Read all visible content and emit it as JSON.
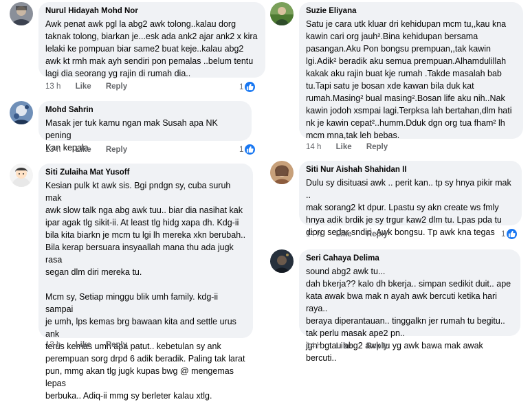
{
  "comments": [
    {
      "author": "Nurul Hidayah Mohd Nor",
      "text": "Awk penat awk pgl la abg2 awk tolong..kalau dorg\ntaknak tolong, biarkan je...esk ada ank2 ajar ank2 x kira\nlelaki ke pompuan biar same2 buat keje..kalau abg2\nawk kt rmh mak ayh sendiri pon pemalas ..belum tentu\nlagi dia seorang yg rajin di rumah dia..",
      "time": "13 h",
      "like": "Like",
      "reply": "Reply",
      "reaction_count": "1",
      "avatar_icon": "profile-photo-icon"
    },
    {
      "author": "Mohd Sahrin",
      "text": "Masak jer tuk kamu ngan mak Susah apa NK pening\nKan kepala",
      "time": "13 h",
      "like": "Like",
      "reply": "Reply",
      "reaction_count": "1",
      "avatar_icon": "profile-photo-icon"
    },
    {
      "author": "Siti Zulaiha Mat Yusoff",
      "text": "Kesian pulk kt awk sis. Bgi pndgn sy, cuba suruh mak\nawk slow talk nga abg awk tuu.. biar dia nasihat kak\nipar agak tlg sikit-ii. At least tlg hidg xapa dh. Kdg-ii\nbila kita biarkn je mcm tu lgi lh mereka xkn berubah..\nBila kerap bersuara insyaallah mana thu ada jugk rasa\nsegan dlm diri mereka tu.\n\nMcm sy, Setiap minggu blik umh family. kdg-ii sampai\nje umh, lps kemas brg bawaan kita and settle urus ank\nterus kemas umh apa patut.. kebetulan sy ank\nperempuan sorg drpd 6 adik beradik. Paling tak larat\npun, mmg akan tlg jugk kupas bwg @ mengemas lepas\nberbuka.. Adiq-ii mmg sy berleter kalau xtlg.",
      "time": "13 h",
      "like": "Like",
      "reply": "Reply",
      "avatar_icon": "cartoon-avatar-icon"
    },
    {
      "author": "Suzie Eliyana",
      "text": "Satu je cara utk kluar dri kehidupan mcm tu,,kau kna\nkawin cari org jauh².Bina kehidupan bersama\npasangan.Aku Pon bongsu prempuan,,tak kawin\nlgi.Adik² beradik aku semua prempuan.Alhamdulillah\nkakak aku rajin buat kje rumah .Takde masalah bab\ntu.Tapi satu je bosan xde kawan bila duk kat\nrumah.Masing² bual masing².Bosan life aku nih..Nak\nkawin jodoh xsmpai lagi.Terpksa lah bertahan,dlm hati\nnk je kawin cepat²..humm.Dduk dgn org tua fham² lh\nmcm mna,tak leh bebas.",
      "time": "14 h",
      "like": "Like",
      "reply": "Reply",
      "avatar_icon": "profile-photo-icon"
    },
    {
      "author": "Siti Nur Aishah Shahidan II",
      "text": "Dulu sy disituasi awk .. perit kan.. tp sy hnya pikir mak ..\nmak sorang2 kt dpur. Lpastu sy akn create ws fmly\nhnya adik brdik je sy trgur kaw2 dlm tu. Lpas pda tu\ndiorg sedar sndiri. Awk bongsu. Tp awk kna tegas",
      "time": "14 h",
      "like": "Like",
      "reply": "Reply",
      "reaction_count": "1",
      "avatar_icon": "profile-photo-icon"
    },
    {
      "author": "Seri Cahaya Delima",
      "text": "sound abg2 awk tu...\ndah bkerja?? kalo dh bkerja.. simpan sedikit duit.. ape\nkata awak bwa mak n ayah awk bercuti ketika hari raya..\nberaya diperantauan.. tinggalkn jer rumah tu begitu..\ntak perlu masak ape2 pn..\njgn bgtau abg2 awk tu yg awk bawa mak awak bercuti..",
      "time": "14 h",
      "like": "Like",
      "reply": "Reply",
      "avatar_icon": "profile-photo-icon"
    }
  ],
  "colors": {
    "bubble": "#f0f2f5",
    "meta": "#65676b",
    "like_badge": "#1877f2"
  }
}
